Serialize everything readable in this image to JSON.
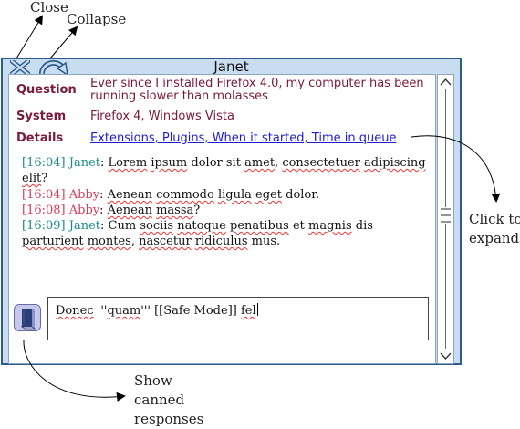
{
  "annotations": {
    "close": "Close",
    "collapse": "Collapse",
    "expand_line1": "Click to",
    "expand_line2": "expand",
    "canned_line1": "Show",
    "canned_line2": "canned",
    "canned_line3": "responses"
  },
  "window": {
    "title": "Janet"
  },
  "info": {
    "question_label": "Question",
    "question_line1": "Ever since I installed Firefox 4.0, my computer has been",
    "question_line2": "running slower than molasses",
    "system_label": "System",
    "system_value": "Firefox 4, Windows Vista",
    "details_label": "Details",
    "details_link": "Extensions, Plugins, When it started, Time in queue"
  },
  "chat": [
    {
      "time": "[16:04]",
      "speaker": "Janet",
      "colon": ":"
    },
    {
      "time": "[16:04]",
      "speaker": "Abby",
      "colon": ":"
    },
    {
      "time": "[16:08]",
      "speaker": "Abby",
      "colon": ":"
    },
    {
      "time": "[16:09]",
      "speaker": "Janet",
      "colon": ":"
    }
  ],
  "messages": {
    "m1": [
      "Lorem",
      " ",
      "ipsum",
      " dolor sit ",
      "amet",
      ", ",
      "consectetuer",
      " ",
      "adipiscing",
      " ",
      "elit",
      "?"
    ],
    "m2": [
      "Aenean",
      " ",
      "commodo",
      " ",
      "ligula",
      " ",
      "eget",
      " dolor."
    ],
    "m3": [
      "Aenean",
      " ",
      "massa",
      "?"
    ],
    "m4": [
      "Cum ",
      "sociis",
      " ",
      "natoque",
      " ",
      "penatibus",
      " et ",
      "magnis",
      " dis ",
      "parturient",
      " ",
      "montes",
      ", ",
      "nascetur",
      " ",
      "ridiculus",
      " mus."
    ]
  },
  "compose": {
    "parts": [
      "Donec",
      " '''",
      "quam",
      "''' [[Safe Mode]] ",
      "fel"
    ]
  },
  "icons": {
    "close": "close-x-icon",
    "collapse": "collapse-arc-arrow-icon",
    "canned": "book-icon"
  },
  "colors": {
    "window_border": "#2d5c8c",
    "window_bg": "#c9ddf1",
    "label": "#7a1a3c",
    "link": "#1d1dcc",
    "janet": "#1a8a8a",
    "abby": "#dd3b5a"
  }
}
